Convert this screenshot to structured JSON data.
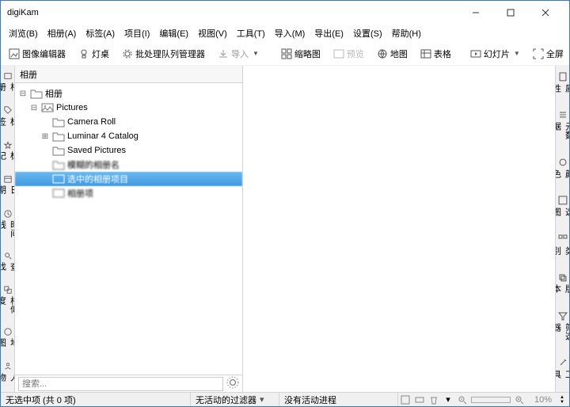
{
  "window": {
    "title": "digiKam"
  },
  "menu": {
    "browse": "浏览(B)",
    "album": "相册(A)",
    "tags": "标签(A)",
    "item": "项目(I)",
    "edit": "编辑(E)",
    "view": "视图(V)",
    "tools": "工具(T)",
    "import": "导入(M)",
    "export": "导出(E)",
    "settings": "设置(S)",
    "help": "帮助(H)"
  },
  "toolbar": {
    "editor": "图像编辑器",
    "lighttable": "灯桌",
    "batch": "批处理队列管理器",
    "import": "导入",
    "thumbs": "缩略图",
    "preview": "预览",
    "map": "地图",
    "tables": "表格",
    "slideshow": "幻灯片",
    "fullscreen": "全屏"
  },
  "left_tabs": [
    "相册",
    "标签",
    "标记",
    "日期",
    "时间线",
    "查找",
    "相似度",
    "地图",
    "人物"
  ],
  "right_tabs": [
    "属性",
    "元数据",
    "颜色",
    "选图",
    "类别",
    "版本",
    "筛选器",
    "工具"
  ],
  "panel": {
    "header": "相册"
  },
  "tree": {
    "root": "相册",
    "pictures": "Pictures",
    "camera": "Camera Roll",
    "luminar": "Luminar 4 Catalog",
    "saved": "Saved Pictures",
    "n5": "模糊的相册名",
    "n6": "选中的相册项目",
    "n7": "相册项"
  },
  "search": {
    "placeholder": "搜索..."
  },
  "status": {
    "selection": "无选中项 (共 0 项)",
    "filter": "无活动的过滤器",
    "progress": "没有活动进程",
    "zoom": "10%"
  }
}
